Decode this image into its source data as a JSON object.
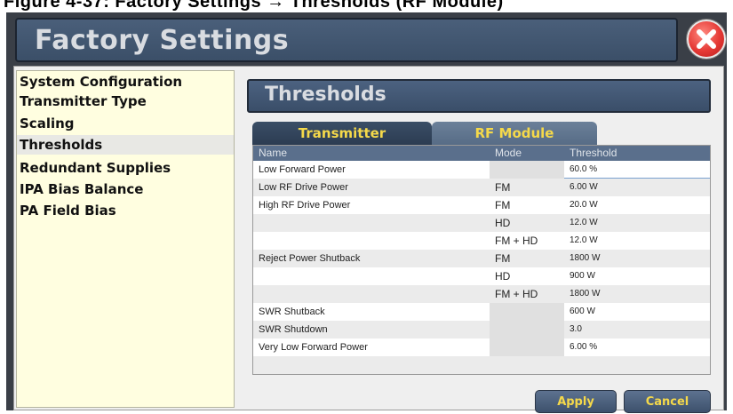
{
  "caption": "Figure 4-37: Factory Settings → Thresholds (RF Module)",
  "window": {
    "title": "Factory Settings"
  },
  "sidebar": {
    "items": [
      {
        "label": "System Configuration",
        "active": false
      },
      {
        "label": "Transmitter Type",
        "active": false
      },
      {
        "label": "Scaling",
        "active": false
      },
      {
        "label": "Thresholds",
        "active": true
      },
      {
        "label": "Redundant Supplies",
        "active": false
      },
      {
        "label": "IPA Bias Balance",
        "active": false
      },
      {
        "label": "PA Field Bias",
        "active": false
      }
    ]
  },
  "section": {
    "title": "Thresholds"
  },
  "tabs": [
    {
      "label": "Transmitter",
      "active": true
    },
    {
      "label": "RF Module",
      "active": false
    }
  ],
  "table": {
    "columns": [
      "Name",
      "Mode",
      "Threshold"
    ],
    "rows": [
      {
        "name": "Low Forward Power",
        "mode": "",
        "threshold": "60.0 %"
      },
      {
        "name": "Low RF Drive Power",
        "mode": "FM",
        "threshold": "6.00 W"
      },
      {
        "name": "High RF Drive Power",
        "mode": "FM",
        "threshold": "20.0 W"
      },
      {
        "name": "",
        "mode": "HD",
        "threshold": "12.0 W"
      },
      {
        "name": "",
        "mode": "FM + HD",
        "threshold": "12.0 W"
      },
      {
        "name": "Reject Power Shutback",
        "mode": "FM",
        "threshold": "1800 W"
      },
      {
        "name": "",
        "mode": "HD",
        "threshold": "900 W"
      },
      {
        "name": "",
        "mode": "FM + HD",
        "threshold": "1800 W"
      },
      {
        "name": "SWR Shutback",
        "mode": "",
        "threshold": "600 W"
      },
      {
        "name": "SWR Shutdown",
        "mode": "",
        "threshold": "3.0"
      },
      {
        "name": "Very Low Forward Power",
        "mode": "",
        "threshold": "6.00 %"
      },
      {
        "name": "",
        "mode": "",
        "threshold": ""
      }
    ]
  },
  "buttons": {
    "apply": "Apply",
    "cancel": "Cancel"
  },
  "colors": {
    "tab_text": "#f5d94a",
    "header_bg": "#3b4f68",
    "sidebar_bg": "#fffee0"
  }
}
